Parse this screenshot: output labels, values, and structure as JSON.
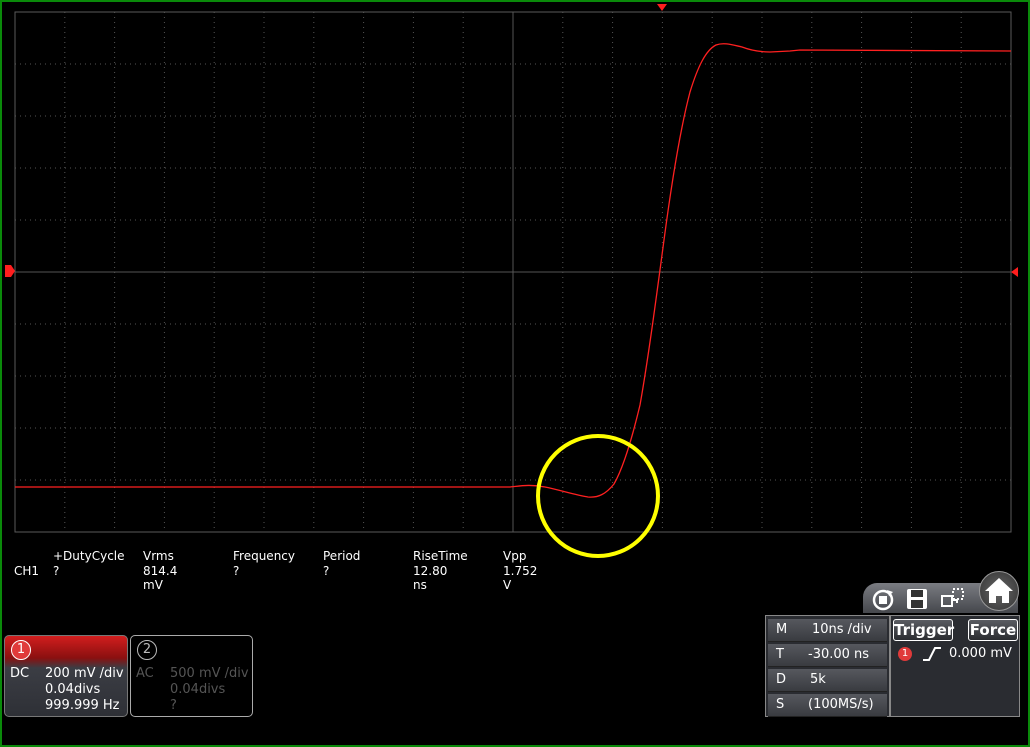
{
  "measurements": [
    {
      "label": "+DutyCycle",
      "value": "?"
    },
    {
      "label": "Vrms",
      "value": "814.4 mV"
    },
    {
      "label": "Frequency",
      "value": "?"
    },
    {
      "label": "Period",
      "value": "?"
    },
    {
      "label": "RiseTime",
      "value": "12.80 ns"
    },
    {
      "label": "Vpp",
      "value": "1.752 V"
    }
  ],
  "measure_channel": "CH1",
  "ch1": {
    "num": "1",
    "coupling": "DC",
    "scale": "200 mV /div",
    "offset": "0.04divs",
    "freq": "999.999 Hz"
  },
  "ch2": {
    "num": "2",
    "coupling": "AC",
    "scale": "500 mV /div",
    "offset": "0.04divs",
    "freq": "?"
  },
  "timebase": {
    "m_label": "M",
    "m_value": "10ns /div",
    "t_label": "T",
    "t_value": "-30.00 ns",
    "d_label": "D",
    "d_value": "5k",
    "s_label": "S",
    "s_value": "(100MS/s)"
  },
  "trigger": {
    "trigger_label": "Trigger",
    "force_label": "Force",
    "channel": "1",
    "level": "0.000 mV"
  },
  "icons": [
    "auto-icon",
    "save-icon",
    "window-switch-icon",
    "home-icon"
  ],
  "colors": {
    "trace": "#ff2020",
    "highlight": "#ffff00",
    "frame": "#0a8a0a",
    "grid": "#555555"
  }
}
